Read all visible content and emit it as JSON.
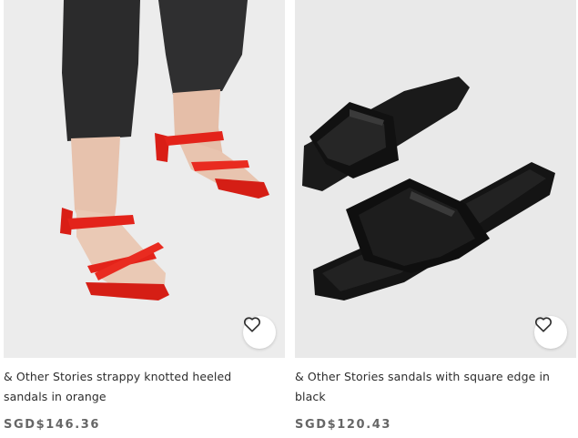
{
  "products": [
    {
      "title": "& Other Stories strappy knotted heeled sandals in orange",
      "price": "SGD$146.36",
      "icon": "heart-icon",
      "image_bg": "#ececec",
      "shoe_color": "#e3231a"
    },
    {
      "title": "& Other Stories sandals with square edge in black",
      "price": "SGD$120.43",
      "icon": "heart-icon",
      "image_bg": "#e9e9e9",
      "shoe_color": "#121212"
    }
  ]
}
